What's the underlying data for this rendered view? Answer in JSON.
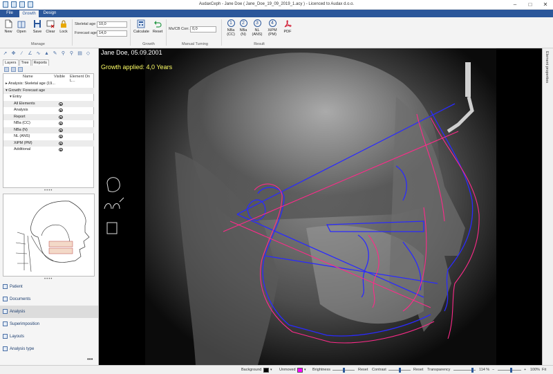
{
  "app": {
    "title": "AudaxCeph - Jane Doe ( Jane_Doe_19_09_2019_1.acy ) - Licenced to Audax d.o.o."
  },
  "tabs": [
    {
      "label": "File"
    },
    {
      "label": "Growth"
    },
    {
      "label": "Design"
    }
  ],
  "ribbon": {
    "manage": {
      "label": "Manage",
      "buttons": [
        {
          "label": "New",
          "icon": "new-document-icon"
        },
        {
          "label": "Open",
          "icon": "open-book-icon"
        },
        {
          "label": "Save",
          "icon": "floppy-disk-icon"
        },
        {
          "label": "Clear",
          "icon": "clear-icon"
        },
        {
          "label": "Lock",
          "icon": "lock-icon"
        }
      ]
    },
    "fields": {
      "skeletal_age_label": "Skeletal age",
      "skeletal_age_value": "10,0",
      "forecast_age_label": "Forecast age",
      "forecast_age_value": "14,0"
    },
    "growth": {
      "label": "Growth",
      "calculate_label": "Calculate",
      "reset_label": "Reset"
    },
    "manual_turning": {
      "label": "Manual Turning",
      "field_label": "Ms/CB Corr.",
      "field_value": "0,0"
    },
    "result": {
      "label": "Result",
      "buttons": [
        {
          "number": "1",
          "line1": "NBa",
          "line2": "(CC)"
        },
        {
          "number": "2",
          "line1": "NBa",
          "line2": "(N)"
        },
        {
          "number": "3",
          "line1": "NL",
          "line2": "(ANS)"
        },
        {
          "number": "4",
          "line1": "XiPM",
          "line2": "(PM)"
        }
      ],
      "pdf_label": "PDF"
    }
  },
  "panel": {
    "tabs": [
      "Layers",
      "Tree",
      "Reports"
    ],
    "columns": [
      "Name",
      "Visible",
      "Element On L..."
    ],
    "rows": [
      {
        "name": "▸ Analysis: Skeletal age (19...",
        "indent": 0,
        "eye": false
      },
      {
        "name": "▾ Growth: Forecast age",
        "indent": 0,
        "eye": false
      },
      {
        "name": "▾ Entry",
        "indent": 1,
        "eye": false
      },
      {
        "name": "All Elements",
        "indent": 2,
        "eye": true
      },
      {
        "name": "Analysis",
        "indent": 2,
        "eye": true
      },
      {
        "name": "Report",
        "indent": 2,
        "eye": true
      },
      {
        "name": "NBa (CC)",
        "indent": 2,
        "eye": true
      },
      {
        "name": "NBa (N)",
        "indent": 2,
        "eye": true
      },
      {
        "name": "NL (ANS)",
        "indent": 2,
        "eye": true
      },
      {
        "name": "XiPM (PM)",
        "indent": 2,
        "eye": true
      },
      {
        "name": "Additional",
        "indent": 2,
        "eye": true
      }
    ]
  },
  "nav": [
    {
      "label": "Patient",
      "selected": false
    },
    {
      "label": "Documents",
      "selected": false
    },
    {
      "label": "Analysis",
      "selected": true
    },
    {
      "label": "Superimposition",
      "selected": false
    },
    {
      "label": "Layouts",
      "selected": false
    },
    {
      "label": "Analysis type",
      "selected": false
    }
  ],
  "viewer": {
    "patient_line": "Jane Doe, 05.09.2001",
    "growth_line": "Growth applied: 4,0 Years"
  },
  "right_strip": {
    "label": "Element properties"
  },
  "statusbar": {
    "background_label": "Background",
    "unmoved_label": "Unmoved",
    "brightness_label": "Brightness",
    "reset1_label": "Reset",
    "contrast_label": "Contrast",
    "reset2_label": "Reset",
    "transparency_label": "Transparency",
    "zoom_value": "114 %",
    "zoom_value2": "100%",
    "fit_label": "Fit"
  },
  "colors": {
    "accent": "#2b579a",
    "trace_blue": "#2a2aff",
    "trace_pink": "#ff2a8a",
    "background_swatch": "#000000",
    "unmoved_swatch": "#ff00ff"
  }
}
